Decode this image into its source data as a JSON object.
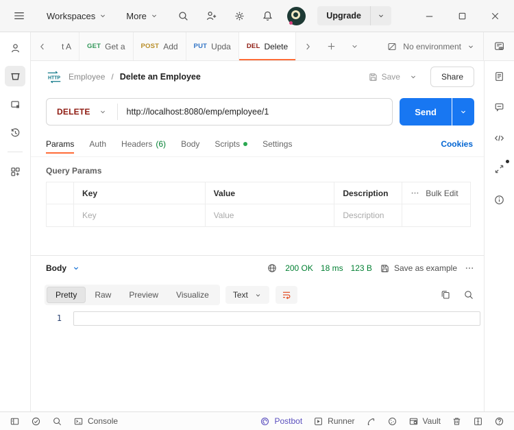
{
  "topbar": {
    "workspaces_label": "Workspaces",
    "more_label": "More",
    "upgrade_label": "Upgrade"
  },
  "tabbar": {
    "tabs": [
      {
        "method": "",
        "label": "t A"
      },
      {
        "method": "GET",
        "label": "Get a"
      },
      {
        "method": "POST",
        "label": "Add"
      },
      {
        "method": "PUT",
        "label": "Upda"
      },
      {
        "method": "DEL",
        "label": "Delete"
      }
    ],
    "active_tab_index": 4,
    "environment_selector": {
      "label": "No environment"
    }
  },
  "header": {
    "breadcrumb": {
      "collection": "Employee",
      "separator": "/",
      "request_name": "Delete an Employee"
    },
    "save_label": "Save",
    "share_label": "Share"
  },
  "request": {
    "method": "DELETE",
    "url": "http://localhost:8080/emp/employee/1",
    "send_label": "Send"
  },
  "request_tabs": {
    "params": "Params",
    "auth": "Auth",
    "headers": "Headers",
    "headers_count": "(6)",
    "body": "Body",
    "scripts": "Scripts",
    "settings": "Settings",
    "cookies_link": "Cookies",
    "active_tab": "Params"
  },
  "query_params": {
    "title": "Query Params",
    "columns": {
      "key": "Key",
      "value": "Value",
      "description": "Description"
    },
    "bulk_edit_label": "Bulk Edit",
    "placeholders": {
      "key": "Key",
      "value": "Value",
      "description": "Description"
    }
  },
  "response": {
    "body_label": "Body",
    "status": "200 OK",
    "time": "18 ms",
    "size": "123 B",
    "save_as_example_label": "Save as example",
    "views": {
      "pretty": "Pretty",
      "raw": "Raw",
      "preview": "Preview",
      "visualize": "Visualize"
    },
    "active_view": "Pretty",
    "format_label": "Text",
    "line_number": "1",
    "body_content": ""
  },
  "statusbar": {
    "console_label": "Console",
    "postbot_label": "Postbot",
    "runner_label": "Runner",
    "vault_label": "Vault"
  },
  "colors": {
    "accent_orange": "#ff6c37",
    "send_blue": "#1877f2",
    "link_blue": "#0265d2",
    "status_green": "#007f31",
    "scripts_dot_green": "#2aa851",
    "method_get": "#007f31",
    "method_post": "#ad7a03",
    "method_put": "#0053b8",
    "method_delete": "#8e1a10",
    "postbot_purple": "#5a4fbe",
    "http_badge_teal": "#0f7787"
  },
  "icons": {
    "menu": "hamburger-lines",
    "search": "magnifier",
    "invite-user": "person-plus",
    "settings": "gear",
    "notifications": "bell",
    "minimize": "line",
    "maximize": "square",
    "close": "x",
    "back": "chevron-left",
    "forward": "chevron-right",
    "add-tab": "plus",
    "caret": "chevron-down",
    "no-environment": "slashed-box",
    "environment-quick-look": "panel-eye",
    "http-request": "HTTP",
    "save": "floppy-disk",
    "more-options": "three-dots",
    "globe": "globe",
    "copy": "overlapping-squares",
    "wrap-line": "curved-return-arrow",
    "console": "terminal-box",
    "checks": "check-circle",
    "postbot": "spiral",
    "runner": "play-square",
    "capture": "curved-arrow",
    "cookies": "cookie",
    "vault": "table-lock",
    "trash": "trash-can",
    "split-pane": "split-square",
    "help": "question-circle"
  }
}
